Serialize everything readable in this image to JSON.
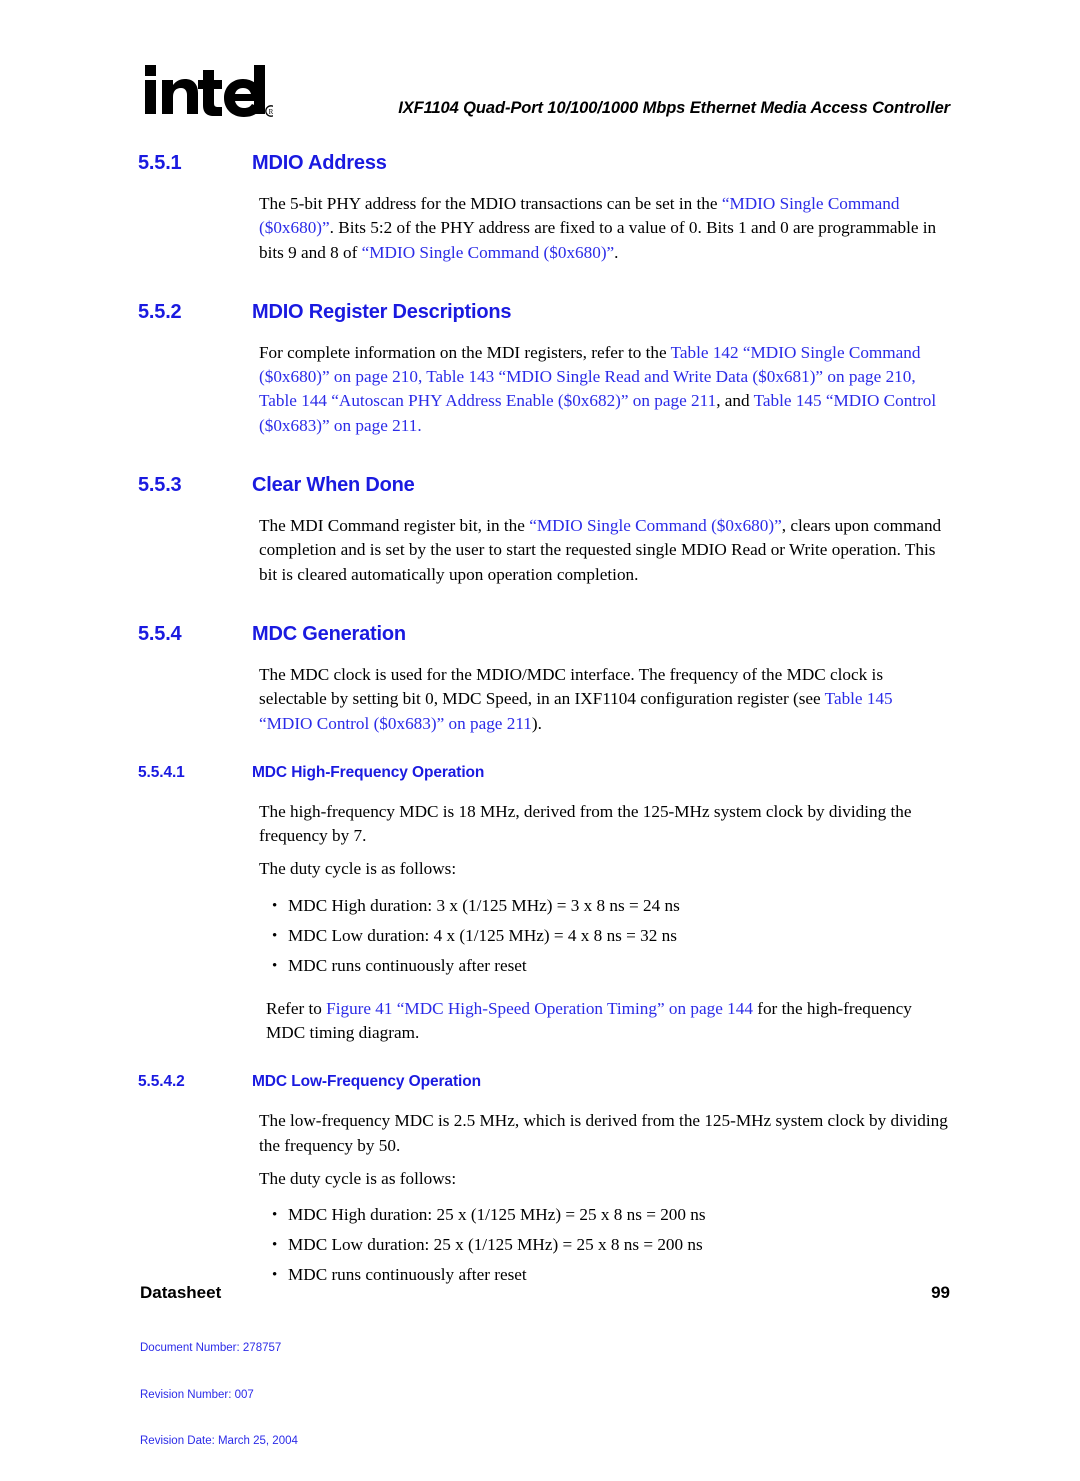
{
  "header": {
    "logo_alt": "intel",
    "logo_registered": "®",
    "title": "IXF1104 Quad-Port 10/100/1000 Mbps Ethernet Media Access Controller"
  },
  "colors": {
    "heading_blue": "#1A1AE0",
    "link_blue": "#2B2BE8",
    "body_black": "#000000"
  },
  "sections": {
    "s551": {
      "number": "5.5.1",
      "title": "MDIO Address",
      "p1_a": "The 5-bit PHY address for the MDIO transactions can be set in the ",
      "p1_link1": "“MDIO Single Command ($0x680)”",
      "p1_b": ". Bits 5:2 of the PHY address are fixed to a value of 0. Bits 1 and 0 are programmable in bits 9 and 8 of ",
      "p1_link2": "“MDIO Single Command ($0x680)”",
      "p1_c": "."
    },
    "s552": {
      "number": "5.5.2",
      "title": "MDIO Register Descriptions",
      "p1_a": "For complete information on the MDI registers, refer to the ",
      "p1_link1": "Table 142 “MDIO Single Command ($0x680)” on page 210",
      "p1_b": ", ",
      "p1_link2": "Table 143 “MDIO Single Read and Write Data ($0x681)” on page 210",
      "p1_c": ", ",
      "p1_link3": "Table 144 “Autoscan PHY Address Enable ($0x682)” on page 211",
      "p1_d": ", and ",
      "p1_link4": "Table 145 “MDIO Control ($0x683)” on page 211",
      "p1_e": "."
    },
    "s553": {
      "number": "5.5.3",
      "title": "Clear When Done",
      "p1_a": "The MDI Command register bit, in the ",
      "p1_link1": "“MDIO Single Command ($0x680)”",
      "p1_b": ", clears upon command completion and is set by the user to start the requested single MDIO Read or Write operation. This bit is cleared automatically upon operation completion."
    },
    "s554": {
      "number": "5.5.4",
      "title": "MDC Generation",
      "p1_a": "The MDC clock is used for the MDIO/MDC interface. The frequency of the MDC clock is selectable by setting bit 0, MDC Speed, in an IXF1104 configuration register (see ",
      "p1_link1": "Table 145 “MDIO Control ($0x683)” on page 211",
      "p1_b": ")."
    },
    "s5541": {
      "number": "5.5.4.1",
      "title": "MDC High-Frequency Operation",
      "p1": "The high-frequency MDC is 18 MHz, derived from the 125-MHz system clock by dividing the frequency by 7.",
      "p2": "The duty cycle is as follows:",
      "bullets": [
        "MDC High duration: 3 x (1/125 MHz) = 3 x 8 ns = 24 ns",
        "MDC Low duration: 4 x (1/125 MHz) = 4 x 8 ns = 32 ns",
        "MDC runs continuously after reset"
      ],
      "p3_a": "Refer to ",
      "p3_link1": "Figure 41 “MDC High-Speed Operation Timing” on page 144",
      "p3_b": " for the high-frequency MDC timing diagram."
    },
    "s5542": {
      "number": "5.5.4.2",
      "title": "MDC Low-Frequency Operation",
      "p1": "The low-frequency MDC is 2.5 MHz, which is derived from the 125-MHz system clock by dividing the frequency by 50.",
      "p2": "The duty cycle is as follows:",
      "bullets": [
        "MDC High duration: 25 x (1/125 MHz) = 25 x 8 ns = 200 ns",
        "MDC Low duration: 25 x (1/125 MHz) = 25 x 8 ns = 200 ns",
        "MDC runs continuously after reset"
      ]
    }
  },
  "bullet_glyph": "•",
  "footer": {
    "label": "Datasheet",
    "page_number": "99",
    "document_number": "Document Number: 278757",
    "revision_number": "Revision Number: 007",
    "revision_date": "Revision Date: March 25, 2004"
  }
}
